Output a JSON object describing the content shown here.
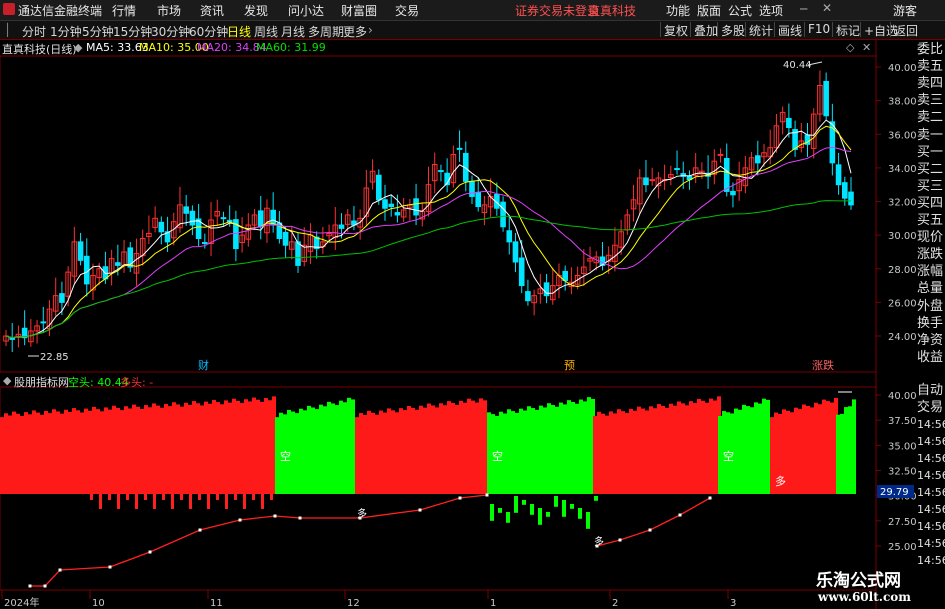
{
  "menubar": {
    "app_title": "通达信金融终端",
    "items": [
      "行情",
      "市场",
      "资讯",
      "发现",
      "问小达",
      "财富圈",
      "交易"
    ],
    "warning": "证券交易未登录",
    "stock": "直真科技",
    "right_items": [
      "功能",
      "版面",
      "公式",
      "选项"
    ],
    "login": "游客"
  },
  "toolbar": {
    "periods": [
      "分时",
      "1分钟",
      "5分钟",
      "15分钟",
      "30分钟",
      "60分钟",
      "日线",
      "周线",
      "月线",
      "多周期",
      "更多"
    ],
    "selected": "日线",
    "buttons": [
      "复权",
      "叠加",
      "多股",
      "统计",
      "画线",
      "F10",
      "标记",
      "+自选",
      "返回"
    ]
  },
  "infobar": {
    "name": "直真科技(日线)",
    "ma5": "MA5: 33.63",
    "ma10": "MA10: 35.00",
    "ma20": "MA20: 34.84",
    "ma60": "MA60: 31.99"
  },
  "price_chart": {
    "yticks": [
      "40.00",
      "38.00",
      "36.00",
      "34.00",
      "32.00",
      "30.00",
      "28.00",
      "26.00",
      "24.00"
    ],
    "high_label": "40.44",
    "low_label": "22.85",
    "markers": [
      "财",
      "预",
      "涨跌"
    ]
  },
  "right_panel": [
    "委比",
    "卖五",
    "卖四",
    "卖三",
    "卖二",
    "卖一",
    "买一",
    "买二",
    "买三",
    "买四",
    "买五",
    "现价",
    "涨跌",
    "涨幅",
    "总量",
    "外盘",
    "换手",
    "净资",
    "收益"
  ],
  "right_panel_lower": [
    "自动",
    "交易",
    "14:56",
    "14:56",
    "14:56",
    "14:56",
    "14:56",
    "14:56",
    "14:56",
    "14:56",
    "14:56"
  ],
  "indicator": {
    "name": "股朋指标网",
    "short_label": "空头: 40.44",
    "long_label": "多头: -",
    "yticks": [
      "40.00",
      "37.50",
      "35.00",
      "32.50",
      "30.00",
      "27.50",
      "25.00"
    ],
    "current": "29.79",
    "segments": [
      {
        "label": "",
        "state": "多"
      },
      {
        "label": "空",
        "state": "空"
      },
      {
        "label": "",
        "state": "多"
      },
      {
        "label": "空",
        "state": "空"
      },
      {
        "label": "",
        "state": "多"
      },
      {
        "label": "空",
        "state": "空"
      },
      {
        "label": "多",
        "state": "多"
      },
      {
        "label": "",
        "state": "空"
      }
    ],
    "line_marks": [
      "多",
      "多"
    ]
  },
  "xaxis": [
    "2024年",
    "10",
    "11",
    "12",
    "1",
    "2",
    "3"
  ],
  "watermark": {
    "title": "乐淘公式网",
    "url": "www.60lt.com"
  },
  "colors": {
    "up": "#ff3030",
    "down": "#00e5ff",
    "ma5": "#ffffff",
    "ma10": "#ffff00",
    "ma20": "#e040fb",
    "ma60": "#00c000",
    "red_fill": "#ff1a1a",
    "green_fill": "#00ff00"
  }
}
